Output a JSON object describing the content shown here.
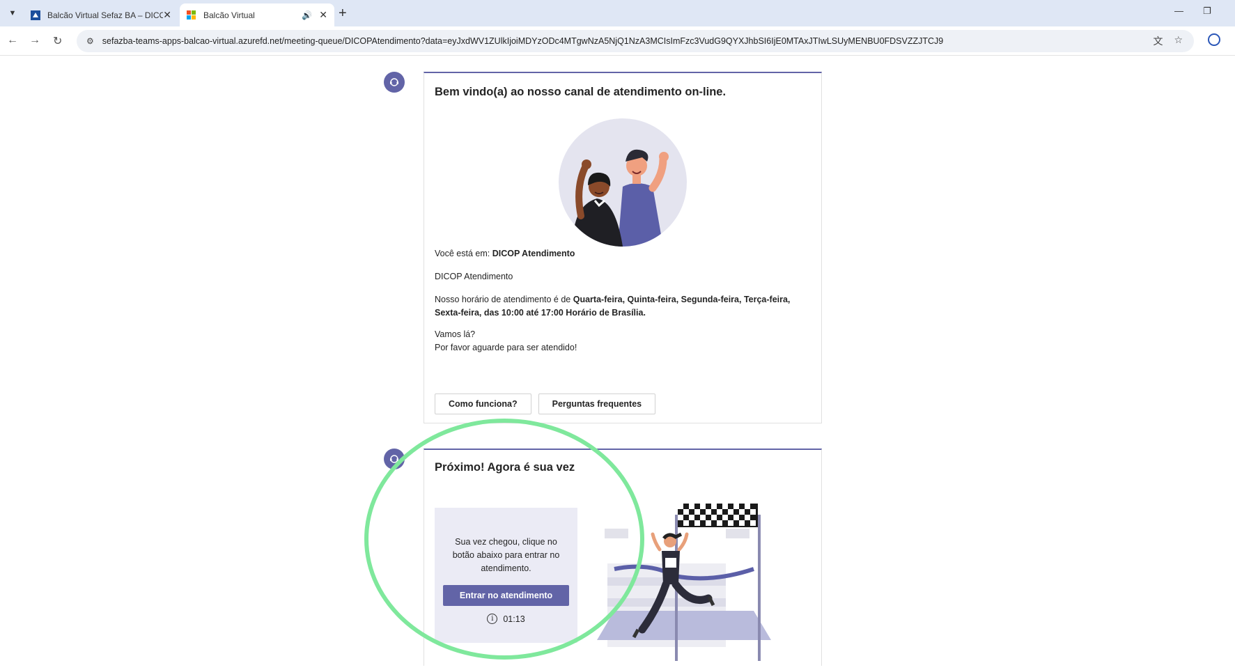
{
  "browser": {
    "tabs": [
      {
        "title": "Balcão Virtual Sefaz BA – DICOP",
        "active": false
      },
      {
        "title": "Balcão Virtual",
        "active": true
      }
    ],
    "url": "sefazba-teams-apps-balcao-virtual.azurefd.net/meeting-queue/DICOPAtendimento?data=eyJxdWV1ZUlkIjoiMDYzODc4MTgwNzA5NjQ1NzA3MCIsImFzc3VudG9QYXJhbSI6IjE0MTAxJTIwLSUyMENBU0FDSVZZJTCJ9"
  },
  "welcome_card": {
    "title": "Bem vindo(a) ao nosso canal de atendimento on-line.",
    "location_prefix": "Você está em: ",
    "location_name": "DICOP Atendimento",
    "queue_name": "DICOP Atendimento",
    "hours_prefix": "Nosso horário de atendimento é de ",
    "hours_bold": "Quarta-feira, Quinta-feira, Segunda-feira, Terça-feira, Sexta-feira, das 10:00 até 17:00 Horário de Brasília.",
    "line_lets_go": "Vamos lá?",
    "line_wait": "Por favor aguarde para ser atendido!",
    "button_how": "Como funciona?",
    "button_faq": "Perguntas frequentes"
  },
  "turn_card": {
    "title": "Próximo! Agora é sua vez",
    "message": "Sua vez chegou, clique no botão abaixo para entrar no atendimento.",
    "enter_button": "Entrar no atendimento",
    "timer": "01:13"
  },
  "colors": {
    "accent": "#6264a7",
    "highlight_ring": "#7fe89c",
    "queue_box_bg": "#ebebf5"
  }
}
